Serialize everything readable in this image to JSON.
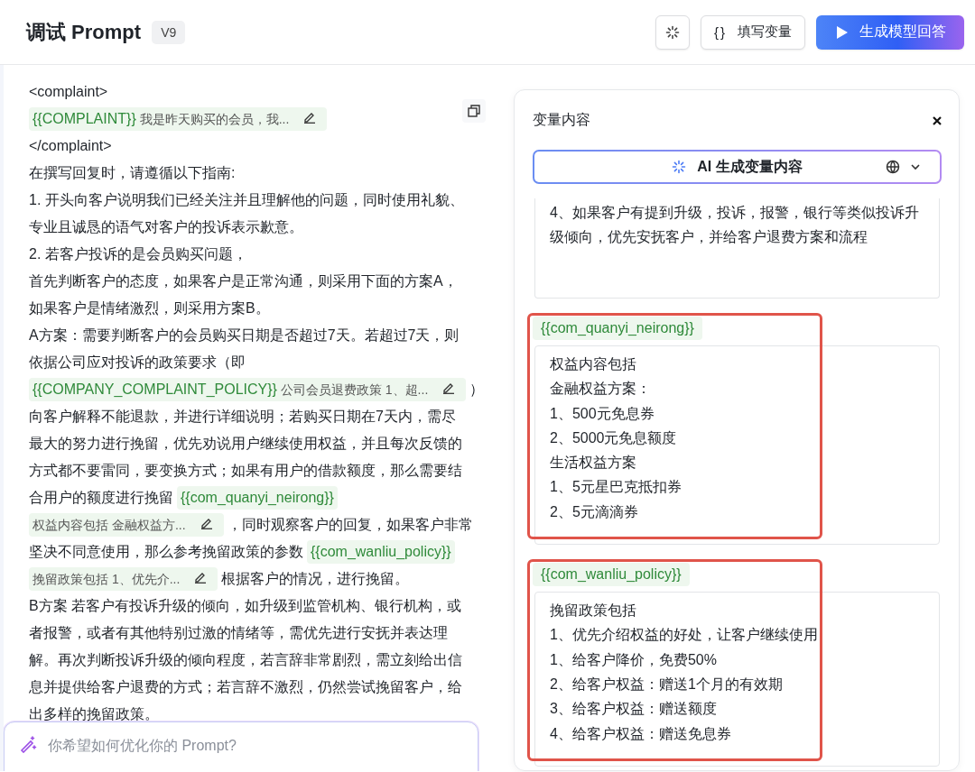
{
  "header": {
    "title": "调试 Prompt",
    "version": "V9",
    "fill_button": {
      "icon_text": "{}",
      "label": "填写变量"
    },
    "run_button": {
      "label": "生成模型回答"
    }
  },
  "prompt": {
    "lines": [
      [
        {
          "kind": "text",
          "text": "<complaint>"
        }
      ],
      [
        {
          "kind": "var",
          "name": "{{COMPLAINT}}",
          "value": "我是昨天购买的会员，我..."
        }
      ],
      [
        {
          "kind": "text",
          "text": "</complaint>"
        }
      ],
      [
        {
          "kind": "text",
          "text": "在撰写回复时，请遵循以下指南:"
        }
      ],
      [
        {
          "kind": "text",
          "text": "1. 开头向客户说明我们已经关注并且理解他的问题，同时使用礼貌、"
        }
      ],
      [
        {
          "kind": "text",
          "text": "专业且诚恳的语气对客户的投诉表示歉意。"
        }
      ],
      [
        {
          "kind": "text",
          "text": "2. 若客户投诉的是会员购买问题，"
        }
      ],
      [
        {
          "kind": "text",
          "text": "首先判断客户的态度，如果客户是正常沟通，则采用下面的方案A，"
        }
      ],
      [
        {
          "kind": "text",
          "text": "如果客户是情绪激烈，则采用方案B。"
        }
      ],
      [
        {
          "kind": "text",
          "text": "A方案：需要判断客户的会员购买日期是否超过7天。若超过7天，则"
        }
      ],
      [
        {
          "kind": "text",
          "text": "依据公司应对投诉的政策要求（即"
        }
      ],
      [
        {
          "kind": "var",
          "name": "{{COMPANY_COMPLAINT_POLICY}}",
          "value": "公司会员退费政策 1、超..."
        },
        {
          "kind": "text",
          "text": "）"
        }
      ],
      [
        {
          "kind": "text",
          "text": "向客户解释不能退款，并进行详细说明；若购买日期在7天内，需尽"
        }
      ],
      [
        {
          "kind": "text",
          "text": "最大的努力进行挽留，优先劝说用户继续使用权益，并且每次反馈的"
        }
      ],
      [
        {
          "kind": "text",
          "text": "方式都不要雷同，要变换方式；如果有用户的借款额度，那么需要结"
        }
      ],
      [
        {
          "kind": "text",
          "text": "合用户的额度进行挽留"
        },
        {
          "kind": "var_name",
          "name": "{{com_quanyi_neirong}}"
        }
      ],
      [
        {
          "kind": "var_value",
          "value": "权益内容包括 金融权益方..."
        },
        {
          "kind": "text",
          "text": "，同时观察客户的回复，如果客户非常"
        }
      ],
      [
        {
          "kind": "text",
          "text": "坚决不同意使用，那么参考挽留政策的参数"
        },
        {
          "kind": "var_name",
          "name": "{{com_wanliu_policy}}"
        }
      ],
      [
        {
          "kind": "var_value",
          "value": "挽留政策包括 1、优先介..."
        },
        {
          "kind": "text",
          "text": "根据客户的情况，进行挽留。"
        }
      ],
      [
        {
          "kind": "text",
          "text": "B方案 若客户有投诉升级的倾向，如升级到监管机构、银行机构，或"
        }
      ],
      [
        {
          "kind": "text",
          "text": "者报警，或者有其他特别过激的情绪等，需优先进行安抚并表达理"
        }
      ],
      [
        {
          "kind": "text",
          "text": "解。再次判断投诉升级的倾向程度，若言辞非常剧烈，需立刻给出信"
        }
      ],
      [
        {
          "kind": "text",
          "text": "息并提供给客户退费的方式；若言辞不激烈，仍然尝试挽留客户，给"
        }
      ],
      [
        {
          "kind": "text",
          "text": "出多样的挽留政策。"
        }
      ]
    ]
  },
  "optimize_box": {
    "placeholder": "你希望如何优化你的 Prompt?"
  },
  "variables_panel": {
    "title": "变量内容",
    "ai_button": {
      "label": "AI 生成变量内容"
    },
    "variables": [
      {
        "lines": [
          "4、如果客户有提到升级，投诉，报警，银行等类似投诉升级倾向，优先安抚客户，并给客户退费方案和流程"
        ],
        "highlighted": false
      },
      {
        "name": "{{com_quanyi_neirong}}",
        "lines": [
          "权益内容包括",
          "金融权益方案：",
          "1、500元免息券",
          "2、5000元免息额度",
          "生活权益方案",
          "1、5元星巴克抵扣券",
          "2、5元滴滴券"
        ],
        "highlighted": true
      },
      {
        "name": "{{com_wanliu_policy}}",
        "lines": [
          "挽留政策包括",
          "1、优先介绍权益的好处，让客户继续使用",
          "1、给客户降价，免费50%",
          "2、给客户权益：赠送1个月的有效期",
          "3、给客户权益：赠送额度",
          "4、给客户权益：赠送免息券"
        ],
        "highlighted": true
      }
    ]
  }
}
